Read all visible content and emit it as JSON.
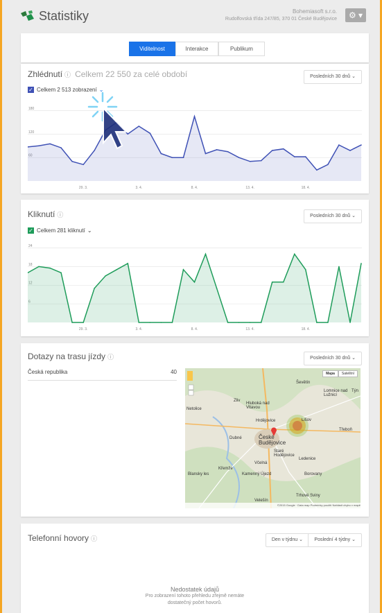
{
  "header": {
    "title": "Statistiky",
    "company_name": "Bohemiasoft s.r.o.",
    "company_address": "Rudolfovská třída 247/85, 370 01 České Budějovice",
    "settings_label": "⚙ ▾"
  },
  "tabs": [
    {
      "label": "Viditelnost",
      "active": true
    },
    {
      "label": "Interakce",
      "active": false
    },
    {
      "label": "Publikum",
      "active": false
    }
  ],
  "views": {
    "title": "Zhlédnutí",
    "total_text": "Celkem 22 550 za celé období",
    "period": "Posledních 30 dnů",
    "series_label": "Celkem 2 513 zobrazení"
  },
  "clicks": {
    "title": "Kliknutí",
    "period": "Posledních 30 dnů",
    "series_label": "Celkem 281 kliknutí"
  },
  "directions": {
    "title": "Dotazy na trasu jízdy",
    "period": "Posledních 30 dnů",
    "country": "Česká republika",
    "count": "40",
    "map_type_buttons": [
      "Mapa",
      "Satelitní"
    ],
    "map_labels": [
      "Ševětín",
      "Lomnice nad Lužnicí",
      "Týn",
      "Hluboká nad Vltavou",
      "Zliv",
      "Hrdějovice",
      "Lišov",
      "České Budějovice",
      "Dubné",
      "Staré Hodějovice",
      "Ledenice",
      "Třeboň",
      "Včelná",
      "Křemže",
      "Kamenný Újezd",
      "Borovany",
      "Blansky les",
      "Trhové Sviny",
      "Velešín",
      "Netolice"
    ],
    "map_attribution": "©2015 Google · Data map   Podmínky použití   Nahlásit chybu v mapě"
  },
  "phone": {
    "title": "Telefonní hovory",
    "granularity": "Den v týdnu",
    "period": "Poslední 4 týdny",
    "nodata_title": "Nedostatek údajů",
    "nodata_text_1": "Pro zobrazení tohoto přehledu zřejmě nemáte",
    "nodata_text_2": "dostatečný počet hovorů."
  },
  "colors": {
    "accent": "#1a73e8",
    "views_line": "#3f51b5",
    "clicks_line": "#1e9c5a",
    "frame": "#f5a623"
  },
  "chart_data": [
    {
      "type": "area",
      "title": "Zhlédnutí",
      "series": [
        {
          "name": "Celkem 2 513 zobrazení",
          "values": [
            87,
            90,
            95,
            85,
            50,
            42,
            78,
            130,
            150,
            120,
            140,
            122,
            70,
            60,
            60,
            165,
            70,
            80,
            75,
            60,
            50,
            52,
            78,
            82,
            62,
            62,
            28,
            42,
            92,
            78,
            92
          ]
        }
      ],
      "x_tick_labels": [
        "29. 3.",
        "3. 4.",
        "8. 4.",
        "13. 4.",
        "18. 4."
      ],
      "y_ticks": [
        60,
        120,
        180
      ],
      "ylim": [
        0,
        195
      ]
    },
    {
      "type": "area",
      "title": "Kliknutí",
      "series": [
        {
          "name": "Celkem 281 kliknutí",
          "values": [
            16,
            18,
            17.5,
            16,
            0,
            0,
            11,
            15,
            17,
            19,
            0,
            0,
            0,
            0,
            17,
            13,
            22,
            11,
            0,
            0,
            0,
            0,
            13,
            13,
            22,
            17,
            0,
            0,
            18,
            0,
            19
          ]
        }
      ],
      "x_tick_labels": [
        "29. 3.",
        "3. 4.",
        "8. 4.",
        "13. 4.",
        "18. 4."
      ],
      "y_ticks": [
        6,
        12,
        18,
        24
      ],
      "ylim": [
        0,
        25
      ]
    }
  ]
}
